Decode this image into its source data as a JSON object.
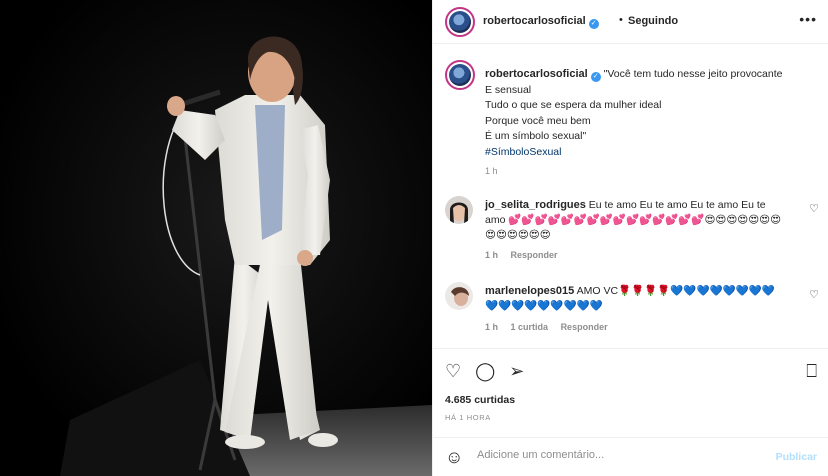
{
  "photo": {
    "alt_description_icon": "performer-on-stage-image"
  },
  "header": {
    "username": "robertocarlosoficial",
    "separator": "•",
    "following_label": "Seguindo",
    "more_icon": "more-options-icon"
  },
  "caption": {
    "username": "robertocarlosoficial",
    "lines": [
      "\"Você tem tudo nesse jeito provocante",
      "E sensual",
      "Tudo o que se espera da mulher ideal",
      "Porque você meu bem",
      "É um símbolo sexual\""
    ],
    "hashtag": "#SímboloSexual",
    "time": "1 h"
  },
  "comments": [
    {
      "username": "jo_selita_rodrigues",
      "text": "Eu te amo Eu te amo Eu te amo Eu te amo 💕💕💕💕💕💕💕💕💕💕💕💕💕💕💕😍😍😍😍😍😍😍😍😍😍😍😍😍",
      "time": "1 h",
      "reply_label": "Responder"
    },
    {
      "username": "marlenelopes015",
      "text": "AMO VC🌹🌹🌹🌹💙💙💙💙💙💙💙💙💙💙💙💙💙💙💙💙💙",
      "time": "1 h",
      "likes_label": "1 curtida",
      "reply_label": "Responder"
    }
  ],
  "actions": {
    "likes": "4.685 curtidas",
    "posted": "HÁ 1 HORA"
  },
  "add_comment": {
    "placeholder": "Adicione um comentário...",
    "publish_label": "Publicar"
  },
  "colors": {
    "link": "#00376b",
    "verified": "#3897f0",
    "publish_disabled": "#b2dffc",
    "story_ring": "#c13584"
  }
}
